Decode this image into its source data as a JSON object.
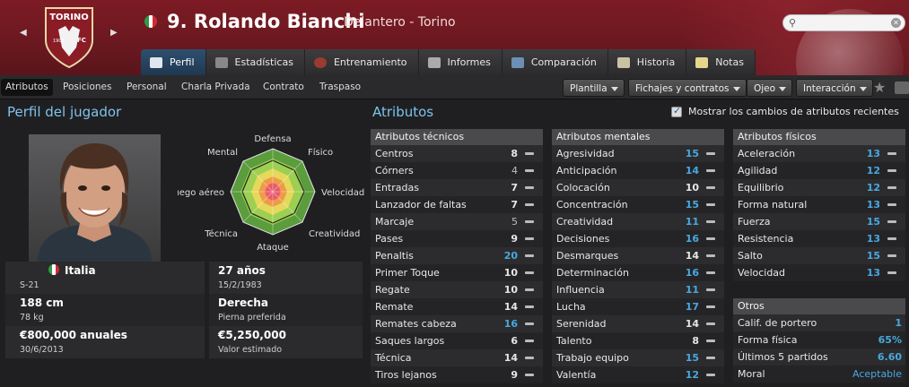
{
  "header": {
    "crest_text": "TORINO",
    "crest_year": "1906",
    "crest_fc": "FC",
    "player_name": "9. Rolando Bianchi",
    "subtitle": "Delantero - Torino",
    "search_placeholder": "",
    "colors": {
      "bg": "#6a1820",
      "accent": "#7ec3ec"
    }
  },
  "main_tabs": [
    {
      "label": "Perfil",
      "icon": "profile-icon",
      "active": true
    },
    {
      "label": "Estadísticas",
      "icon": "stats-icon"
    },
    {
      "label": "Entrenamiento",
      "icon": "training-ball-icon"
    },
    {
      "label": "Informes",
      "icon": "report-icon"
    },
    {
      "label": "Comparación",
      "icon": "compare-icon"
    },
    {
      "label": "Historia",
      "icon": "history-icon"
    },
    {
      "label": "Notas",
      "icon": "notes-icon"
    }
  ],
  "sub_tabs": [
    {
      "label": "Atributos",
      "active": true
    },
    {
      "label": "Posiciones"
    },
    {
      "label": "Personal"
    },
    {
      "label": "Charla Privada"
    },
    {
      "label": "Contrato"
    },
    {
      "label": "Traspaso"
    }
  ],
  "dropdowns": {
    "plantilla": "Plantilla",
    "fichajes": "Fichajes y contratos",
    "ojeo": "Ojeo",
    "interaccion": "Interacción"
  },
  "profile": {
    "title": "Perfil del jugador",
    "radar_labels": {
      "defensa": "Defensa",
      "fisico": "Físico",
      "velocidad": "Velocidad",
      "creatividad": "Creatividad",
      "ataque": "Ataque",
      "tecnica": "Técnica",
      "juego_aereo": "Juego aéreo",
      "mental": "Mental"
    },
    "nationality": "Italia",
    "nationality_sub": "S-21",
    "age": "27 años",
    "birth_date": "15/2/1983",
    "height": "188 cm",
    "weight": "78 kg",
    "foot": "Derecha",
    "foot_label": "Pierna preferida",
    "wage": "€800,000 anuales",
    "contract_end": "30/6/2013",
    "value": "€5,250,000",
    "value_label": "Valor estimado"
  },
  "attributes": {
    "title": "Atributos",
    "show_changes_label": "Mostrar los cambios de atributos recientes",
    "technical": {
      "header": "Atributos técnicos",
      "items": [
        {
          "name": "Centros",
          "value": "8",
          "style": "normal"
        },
        {
          "name": "Córners",
          "value": "4",
          "style": "dim"
        },
        {
          "name": "Entradas",
          "value": "7",
          "style": "normal"
        },
        {
          "name": "Lanzador de faltas",
          "value": "7",
          "style": "normal"
        },
        {
          "name": "Marcaje",
          "value": "5",
          "style": "dim"
        },
        {
          "name": "Pases",
          "value": "9",
          "style": "normal"
        },
        {
          "name": "Penaltis",
          "value": "20",
          "style": "blue"
        },
        {
          "name": "Primer Toque",
          "value": "10",
          "style": "normal"
        },
        {
          "name": "Regate",
          "value": "10",
          "style": "normal"
        },
        {
          "name": "Remate",
          "value": "14",
          "style": "normal"
        },
        {
          "name": "Remates cabeza",
          "value": "16",
          "style": "blue"
        },
        {
          "name": "Saques largos",
          "value": "6",
          "style": "normal"
        },
        {
          "name": "Técnica",
          "value": "14",
          "style": "normal"
        },
        {
          "name": "Tiros lejanos",
          "value": "9",
          "style": "normal"
        }
      ]
    },
    "mental": {
      "header": "Atributos mentales",
      "items": [
        {
          "name": "Agresividad",
          "value": "15",
          "style": "blue"
        },
        {
          "name": "Anticipación",
          "value": "14",
          "style": "blue"
        },
        {
          "name": "Colocación",
          "value": "10",
          "style": "normal"
        },
        {
          "name": "Concentración",
          "value": "15",
          "style": "blue"
        },
        {
          "name": "Creatividad",
          "value": "11",
          "style": "blue"
        },
        {
          "name": "Decisiones",
          "value": "16",
          "style": "blue"
        },
        {
          "name": "Desmarques",
          "value": "14",
          "style": "normal"
        },
        {
          "name": "Determinación",
          "value": "16",
          "style": "blue"
        },
        {
          "name": "Influencia",
          "value": "11",
          "style": "blue"
        },
        {
          "name": "Lucha",
          "value": "17",
          "style": "blue"
        },
        {
          "name": "Serenidad",
          "value": "14",
          "style": "normal"
        },
        {
          "name": "Talento",
          "value": "8",
          "style": "normal"
        },
        {
          "name": "Trabajo equipo",
          "value": "15",
          "style": "blue"
        },
        {
          "name": "Valentía",
          "value": "12",
          "style": "blue"
        }
      ]
    },
    "physical": {
      "header": "Atributos físicos",
      "items": [
        {
          "name": "Aceleración",
          "value": "13",
          "style": "blue"
        },
        {
          "name": "Agilidad",
          "value": "12",
          "style": "blue"
        },
        {
          "name": "Equilibrio",
          "value": "12",
          "style": "blue"
        },
        {
          "name": "Forma natural",
          "value": "13",
          "style": "blue"
        },
        {
          "name": "Fuerza",
          "value": "15",
          "style": "blue"
        },
        {
          "name": "Resistencia",
          "value": "13",
          "style": "blue"
        },
        {
          "name": "Salto",
          "value": "15",
          "style": "blue"
        },
        {
          "name": "Velocidad",
          "value": "13",
          "style": "blue"
        }
      ]
    },
    "others": {
      "header": "Otros",
      "items": [
        {
          "name": "Calif. de portero",
          "value": "1"
        },
        {
          "name": "Forma física",
          "value": "65%"
        },
        {
          "name": "Últimos 5 partidos",
          "value": "6.60"
        },
        {
          "name": "Moral",
          "value": "Aceptable"
        }
      ]
    }
  }
}
